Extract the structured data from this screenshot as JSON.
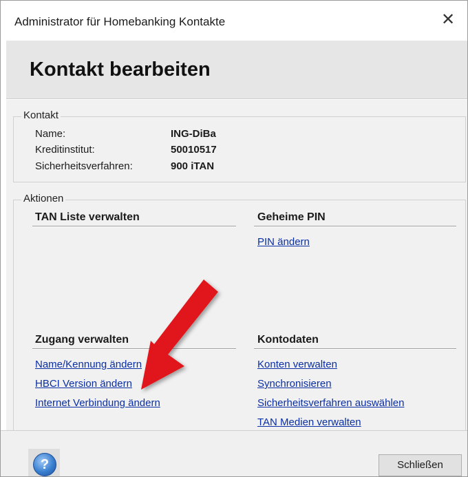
{
  "window": {
    "title": "Administrator für Homebanking Kontakte",
    "close_glyph": "✕"
  },
  "header": {
    "title": "Kontakt bearbeiten"
  },
  "kontakt": {
    "legend": "Kontakt",
    "name_label": "Name:",
    "name_value": "ING-DiBa",
    "institut_label": "Kreditinstitut:",
    "institut_value": "50010517",
    "verfahren_label": "Sicherheitsverfahren:",
    "verfahren_value": "900 iTAN"
  },
  "aktionen": {
    "legend": "Aktionen",
    "tan_liste": {
      "title": "TAN Liste verwalten"
    },
    "pin": {
      "title": "Geheime PIN",
      "links": [
        "PIN ändern"
      ]
    },
    "zugang": {
      "title": "Zugang verwalten",
      "links": [
        "Name/Kennung ändern",
        "HBCI Version ändern",
        "Internet Verbindung ändern"
      ]
    },
    "kontodaten": {
      "title": "Kontodaten",
      "links": [
        "Konten verwalten",
        "Synchronisieren",
        "Sicherheitsverfahren auswählen",
        "TAN Medien verwalten"
      ]
    }
  },
  "footer": {
    "help_glyph": "?",
    "close_button": "Schließen"
  },
  "colors": {
    "link": "#0a2fa4",
    "arrow": "#e0191b",
    "header_bg": "#e6e6e6",
    "content_bg": "#f1f1f1"
  },
  "icons": [
    "close-icon",
    "help-icon",
    "red-arrow-annotation"
  ]
}
